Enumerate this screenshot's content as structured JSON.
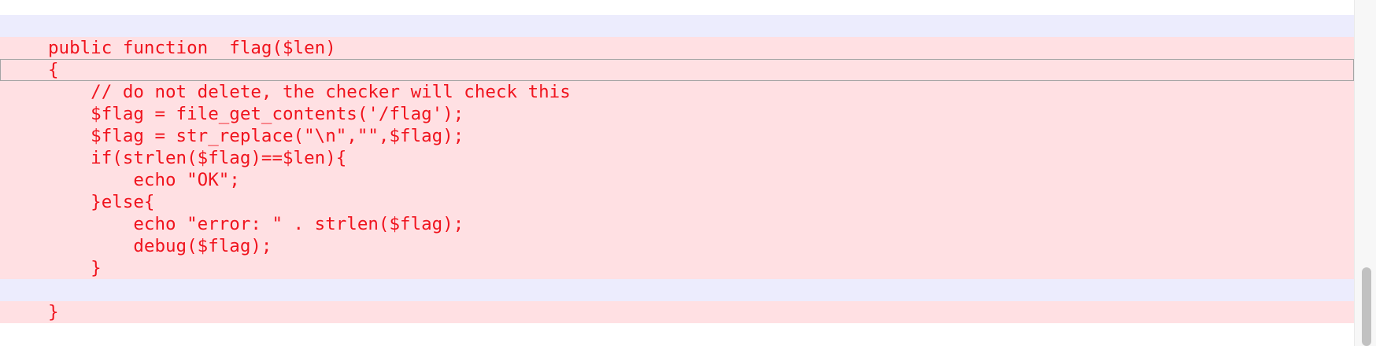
{
  "diff": {
    "lines": [
      {
        "kind": "blank",
        "text": ""
      },
      {
        "kind": "removed",
        "text": "public function  flag($len)"
      },
      {
        "kind": "removed",
        "text": "{"
      },
      {
        "kind": "removed",
        "text": "    // do not delete, the checker will check this"
      },
      {
        "kind": "removed",
        "text": "    $flag = file_get_contents('/flag');"
      },
      {
        "kind": "removed",
        "text": "    $flag = str_replace(\"\\n\",\"\",$flag);"
      },
      {
        "kind": "removed",
        "text": "    if(strlen($flag)==$len){"
      },
      {
        "kind": "removed",
        "text": "        echo \"OK\";"
      },
      {
        "kind": "removed",
        "text": "    }else{"
      },
      {
        "kind": "removed",
        "text": "        echo \"error: \" . strlen($flag);"
      },
      {
        "kind": "removed",
        "text": "        debug($flag);"
      },
      {
        "kind": "removed",
        "text": "    }"
      },
      {
        "kind": "blank",
        "text": ""
      },
      {
        "kind": "removed",
        "text": "}"
      }
    ]
  },
  "colors": {
    "removed_background": "#ffe0e3",
    "removed_text": "#f0141e",
    "blank_background": "#ececfd",
    "cursor_line_border": "#a4a4a4"
  },
  "cursor_line": 2
}
